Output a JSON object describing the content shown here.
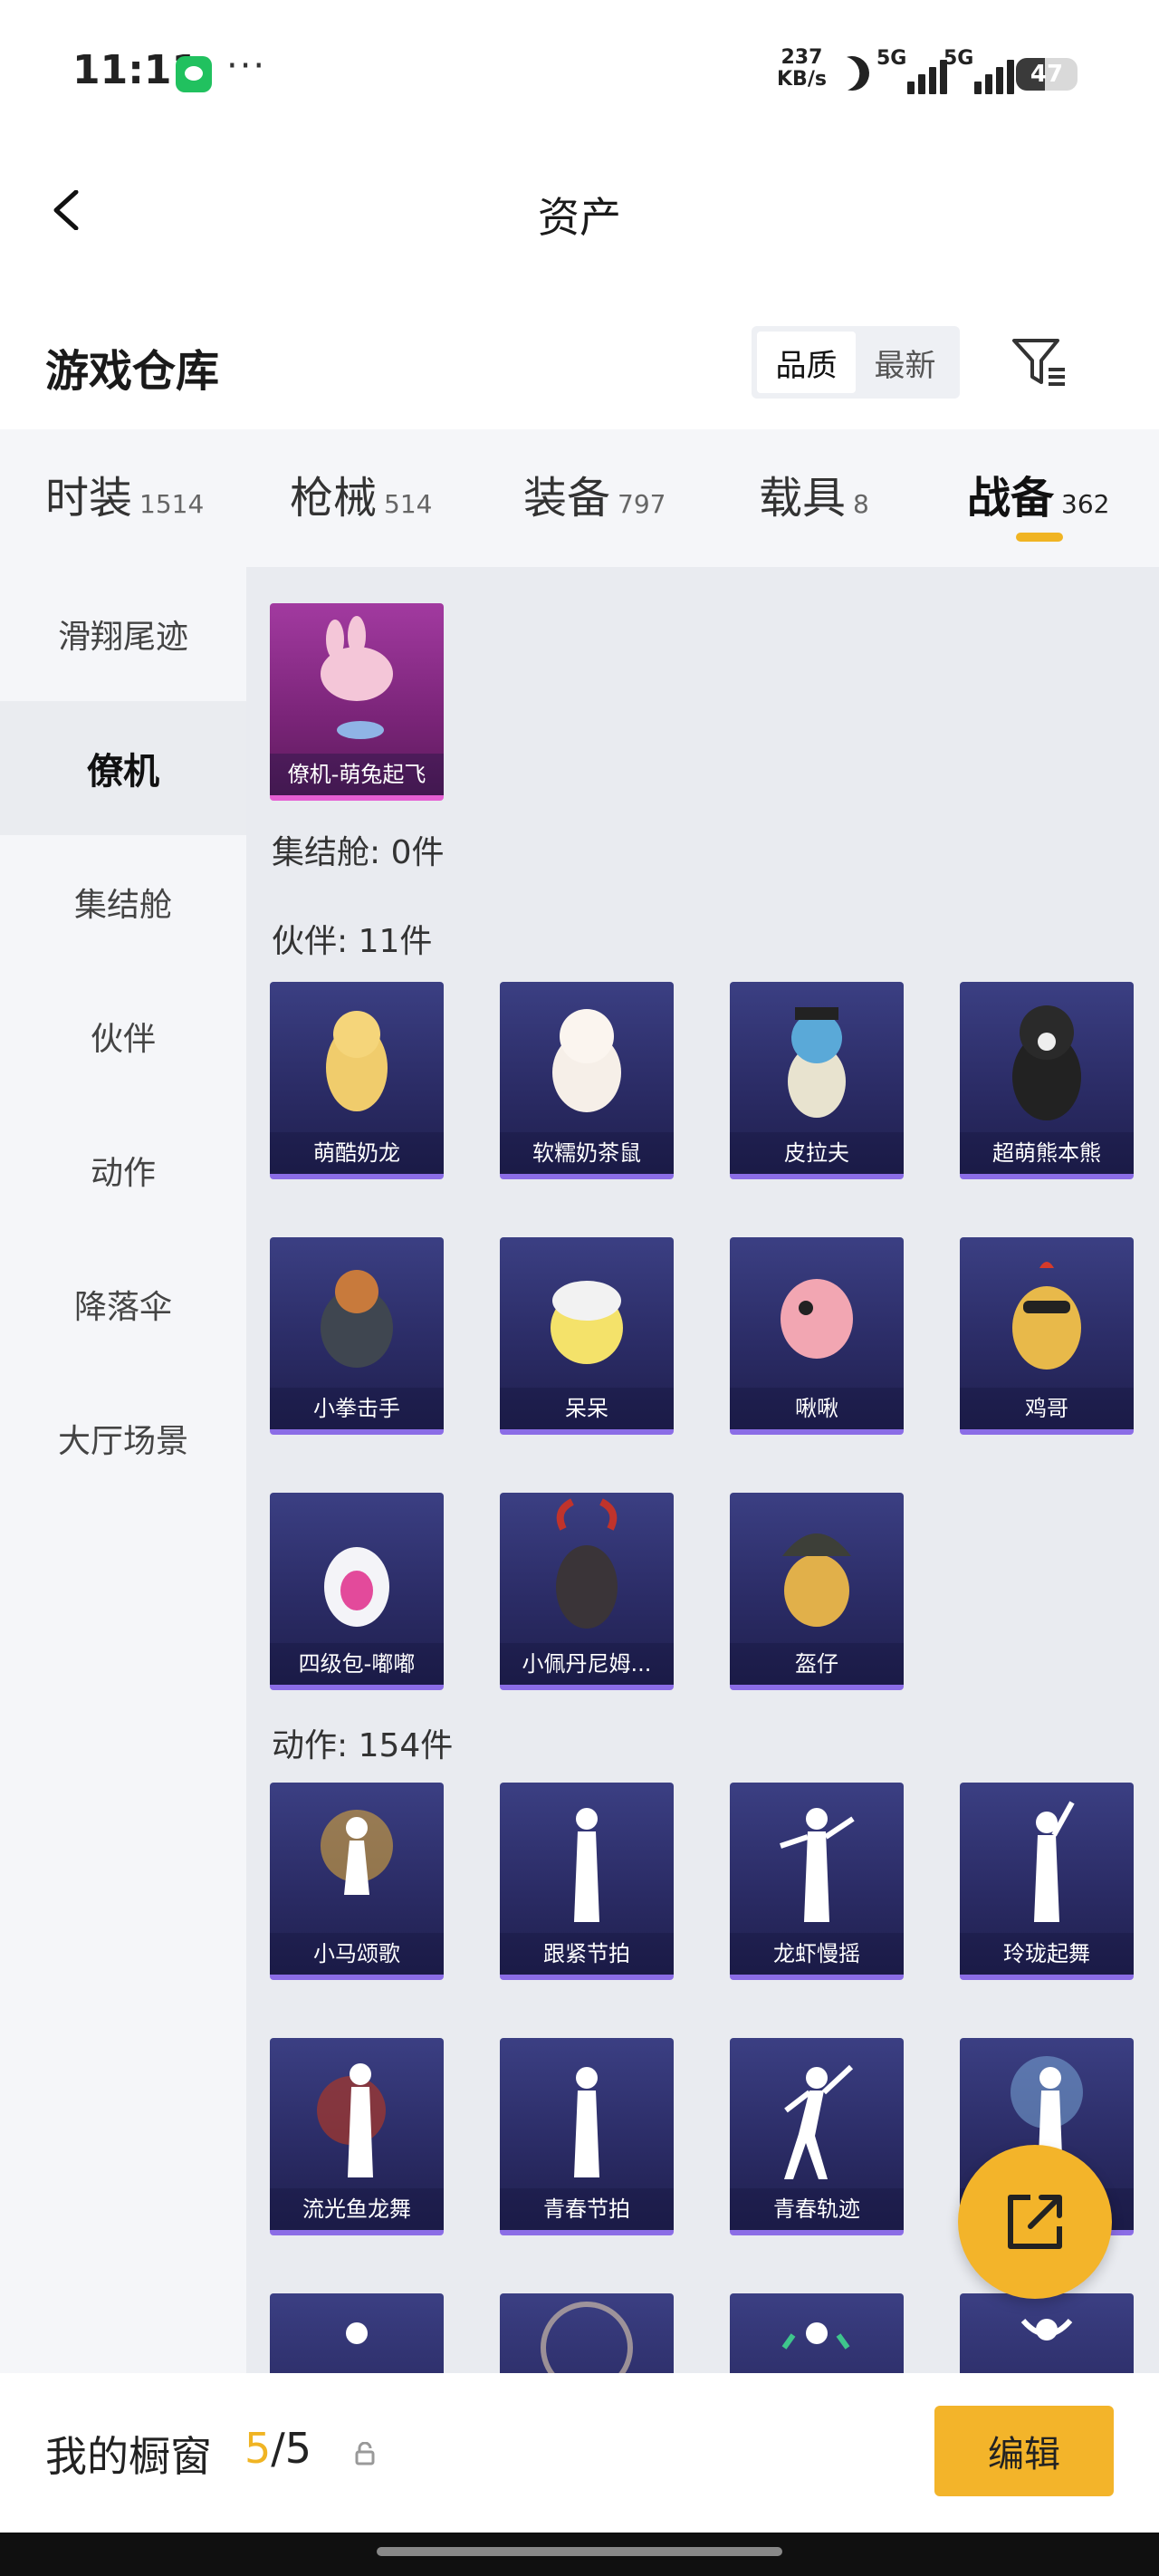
{
  "status_bar": {
    "time": "11:11",
    "more": "···",
    "net_speed_value": "237",
    "net_speed_unit": "KB/s",
    "signal1_label": "5G",
    "signal2_label": "5G",
    "battery": "47",
    "battery_level": 0.47
  },
  "nav": {
    "title": "资产"
  },
  "warehouse": {
    "title": "游戏仓库",
    "sort_options": [
      "品质",
      "最新"
    ],
    "active_sort": 0
  },
  "tabs": [
    {
      "name": "时装",
      "count": "1514"
    },
    {
      "name": "枪械",
      "count": "514"
    },
    {
      "name": "装备",
      "count": "797"
    },
    {
      "name": "载具",
      "count": "8"
    },
    {
      "name": "战备",
      "count": "362",
      "active": true
    }
  ],
  "sidebar": [
    "滑翔尾迹",
    "僚机",
    "集结舱",
    "伙伴",
    "动作",
    "降落伞",
    "大厅场景"
  ],
  "sidebar_active": 1,
  "sections": {
    "wingman_item": "僚机-萌兔起飞",
    "assembly_label": "集结舱: 0件",
    "partner_label": "伙伴: 11件",
    "partners": [
      "萌酷奶龙",
      "软糯奶茶鼠",
      "皮拉夫",
      "超萌熊本熊",
      "小拳击手",
      "呆呆",
      "啾啾",
      "鸡哥",
      "四级包-嘟嘟",
      "小佩丹尼姆...",
      "盔仔"
    ],
    "action_label": "动作: 154件",
    "actions": [
      "小马颂歌",
      "跟紧节拍",
      "龙虾慢摇",
      "玲珑起舞",
      "流光鱼龙舞",
      "青春节拍",
      "青春轨迹",
      ""
    ]
  },
  "bottom": {
    "shelf_label": "我的橱窗",
    "shelf_current": "5",
    "shelf_total": "/5",
    "edit_label": "编辑"
  },
  "colors": {
    "accent": "#f3b42a",
    "card": "#2b2c66",
    "card_pink": "#7a2478"
  }
}
